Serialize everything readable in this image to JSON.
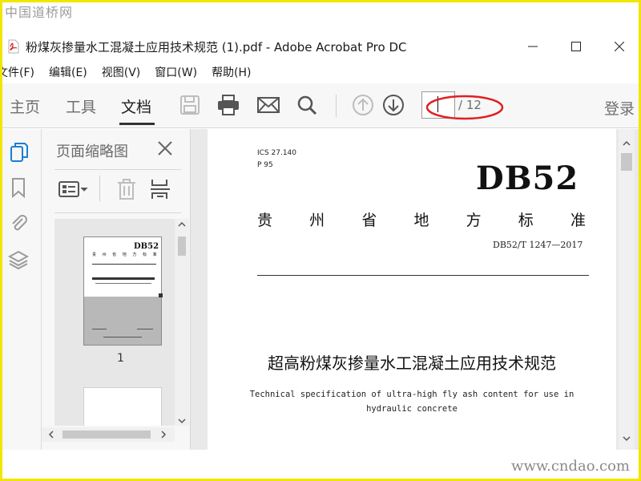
{
  "watermark": {
    "top": "中国道桥网",
    "bottom": "www.cndao.com"
  },
  "window": {
    "title": "粉煤灰掺量水工混凝土应用技术规范 (1).pdf - Adobe Acrobat Pro DC"
  },
  "menu": [
    "文件(F)",
    "编辑(E)",
    "视图(V)",
    "窗口(W)",
    "帮助(H)"
  ],
  "toolbar": {
    "tabs": [
      "主页",
      "工具",
      "文档"
    ],
    "active_tab": "文档",
    "page_current": "1",
    "page_total": "/ 12",
    "login": "登录",
    "icons": [
      "save-icon",
      "print-icon",
      "email-icon",
      "search-icon",
      "page-up-icon",
      "page-down-icon"
    ]
  },
  "panel": {
    "title": "页面缩略图",
    "thumb_page_number": "1"
  },
  "document": {
    "ics": "ICS 27.140",
    "p": "P 95",
    "db": "DB52",
    "gov": [
      "贵",
      "州",
      "省",
      "地",
      "方",
      "标",
      "准"
    ],
    "std_no": "DB52/T 1247—2017",
    "title_zh": "超高粉煤灰掺量水工混凝土应用技术规范",
    "title_en_1": "Technical specification of ultra-high fly ash content for use in",
    "title_en_2": "hydraulic concrete"
  },
  "thumbnail": {
    "db": "DB52",
    "gov": "贵 州 省 地 方 标 准"
  },
  "colors": {
    "accent_blue": "#1a7fd6",
    "annotation_red": "#e02020",
    "frame_yellow": "#f2e600"
  }
}
